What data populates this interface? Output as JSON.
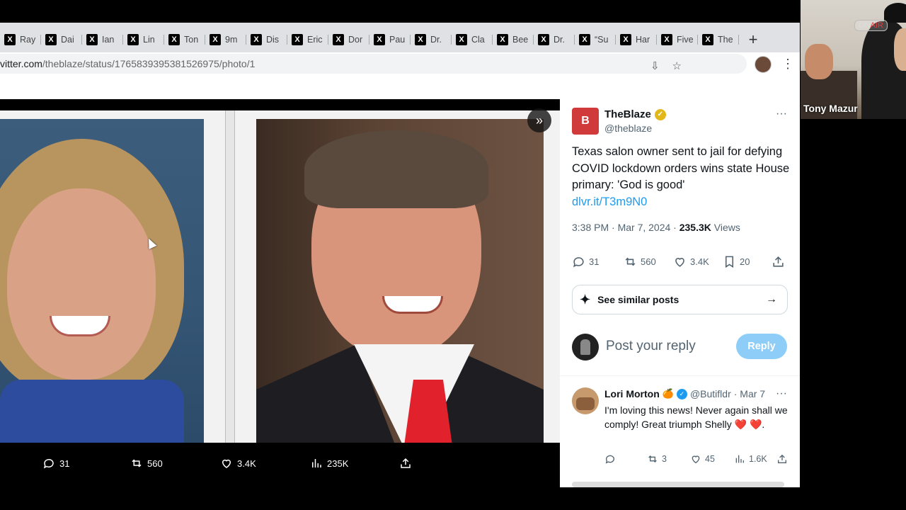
{
  "browser": {
    "tabs": [
      "Ray",
      "Dai",
      "Ian",
      "Lin",
      "Ton",
      "9m",
      "Dis",
      "Eric",
      "Dor",
      "Pau",
      "Dr.",
      "Cla",
      "Bee",
      "Dr.",
      "“Su",
      "Har",
      "Five",
      "The"
    ],
    "new_tab_label": "+",
    "url_prefix": "vitter.com",
    "url_path": "/theblaze/status/1765839395381526975/photo/1"
  },
  "viewer": {
    "next_icon": "double-chevron-right-icon",
    "actions": {
      "replies": "31",
      "reposts": "560",
      "likes": "3.4K",
      "views": "235K"
    }
  },
  "tweet": {
    "avatar_letter": "B",
    "author_name": "TheBlaze",
    "author_handle": "@theblaze",
    "text": "Texas salon owner sent to jail for defying COVID lockdown orders wins state House primary: 'God is good'",
    "link": "dlvr.it/T3m9N0",
    "time": "3:38 PM · Mar 7, 2024 · ",
    "views_count": "235.3K",
    "views_label": " Views",
    "stats": {
      "replies": "31",
      "reposts": "560",
      "likes": "3.4K",
      "bookmarks": "20"
    },
    "similar_label": "See similar posts",
    "reply_placeholder": "Post your reply",
    "reply_button": "Reply"
  },
  "reply": {
    "name": "Lori Morton",
    "handle": "@Butifldr",
    "date": "· Mar 7",
    "text": "I'm loving this news!  Never again shall we comply!  Great triumph Shelly",
    "text_end": ".",
    "stats": {
      "reposts": "3",
      "likes": "45",
      "views": "1.6K"
    }
  },
  "webcam": {
    "sign_on": "ON",
    "sign_air": "AIR",
    "name": "Tony Mazur"
  },
  "colors": {
    "accent": "#1d9bf0",
    "blaze_red": "#d13a3a",
    "reply_button": "#8ecdf8"
  }
}
